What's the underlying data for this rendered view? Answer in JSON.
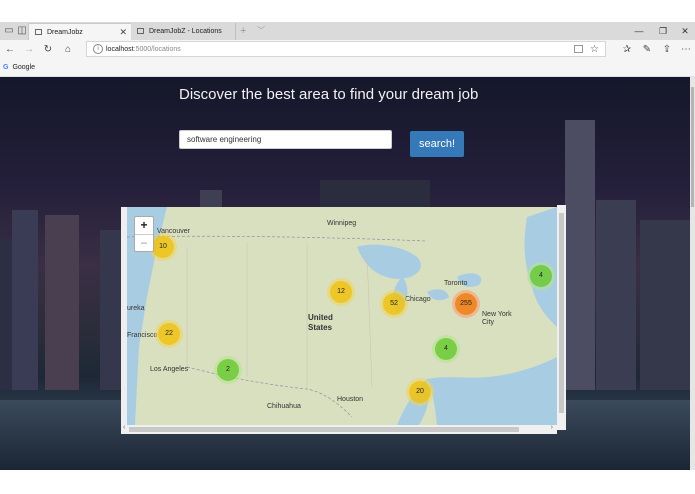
{
  "browser": {
    "tabs": [
      {
        "label": "DreamJobz",
        "active": true
      },
      {
        "label": "DreamJobZ - Locations",
        "active": false
      }
    ],
    "address_host": "localhost",
    "address_path": ":5000/locations",
    "favorites": [
      "Google"
    ]
  },
  "page": {
    "heading": "Discover the best area to find your dream job",
    "search_value": "software engineering",
    "search_button": "search!"
  },
  "map": {
    "zoom_in": "+",
    "zoom_out": "−",
    "places": [
      "Vancouver",
      "Winnipeg",
      "Toronto",
      "New York",
      "City",
      "Chicago",
      "United",
      "States",
      "Los Angeles",
      "Francisco",
      "Houston",
      "Chihuahua",
      "ureka"
    ],
    "clusters": [
      {
        "count": "10",
        "level": "yellow"
      },
      {
        "count": "12",
        "level": "yellow"
      },
      {
        "count": "52",
        "level": "yellow"
      },
      {
        "count": "255",
        "level": "orange"
      },
      {
        "count": "4",
        "level": "green"
      },
      {
        "count": "22",
        "level": "yellow"
      },
      {
        "count": "4",
        "level": "green"
      },
      {
        "count": "2",
        "level": "green"
      },
      {
        "count": "20",
        "level": "yellow"
      }
    ]
  }
}
